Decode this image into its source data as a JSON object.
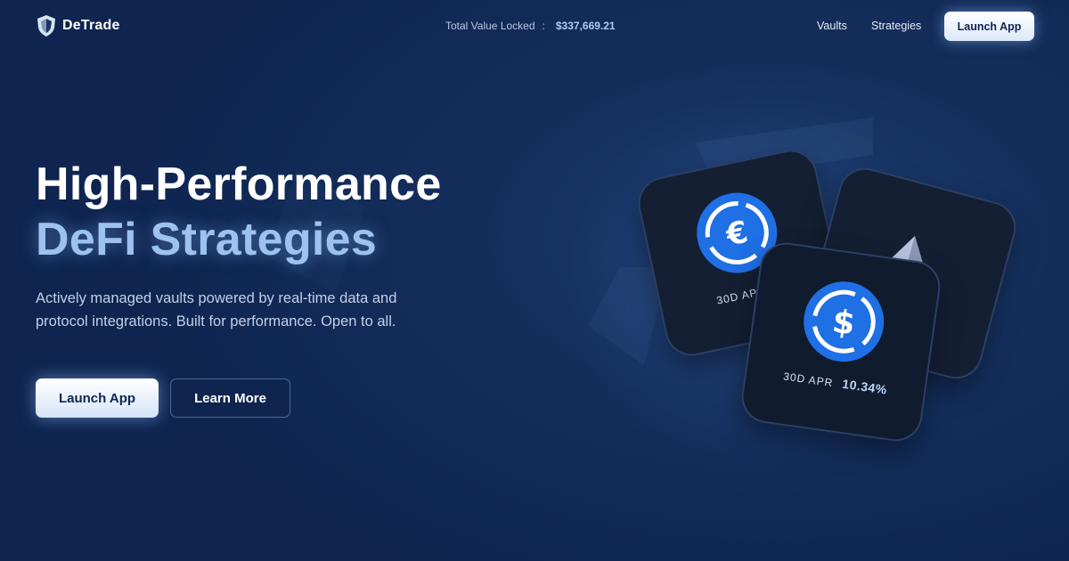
{
  "brand": {
    "name": "DeTrade"
  },
  "tvl": {
    "label": "Total Value Locked",
    "separator": ":",
    "value": "$337,669.21"
  },
  "nav": {
    "vaults": "Vaults",
    "strategies": "Strategies"
  },
  "header_button": "Launch App",
  "hero": {
    "title_line1": "High-Performance",
    "title_line2": "DeFi Strategies",
    "description": "Actively managed vaults powered by real-time data and protocol integrations. Built for performance. Open to all.",
    "primary_button": "Launch App",
    "secondary_button": "Learn More"
  },
  "cards": {
    "euro": {
      "icon": "euro-coin-icon",
      "apr_label": "30D APR"
    },
    "eth": {
      "icon": "ethereum-icon"
    },
    "usd": {
      "icon": "usd-coin-icon",
      "apr_label": "30D APR",
      "apr_value": "10.34%"
    }
  },
  "colors": {
    "background": "#142e5c",
    "accent": "#9dc2ef",
    "coin_blue": "#1f6fe5",
    "card": "#141f33"
  }
}
